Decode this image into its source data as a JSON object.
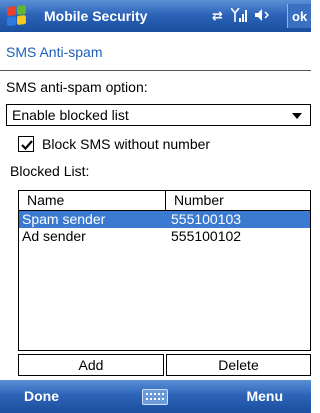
{
  "titlebar": {
    "app_title": "Mobile Security",
    "ok_label": "ok",
    "icons": [
      "connectivity-icon",
      "signal-strength-icon",
      "volume-icon"
    ]
  },
  "page": {
    "title": "SMS Anti-spam",
    "option_label": "SMS anti-spam option:",
    "option_selected": "Enable blocked list",
    "checkbox_label": "Block SMS without number",
    "checkbox_checked": true,
    "blocked_list_label": "Blocked List:"
  },
  "list": {
    "columns": [
      "Name",
      "Number"
    ],
    "rows": [
      {
        "name": "Spam sender",
        "number": "555100103",
        "selected": true
      },
      {
        "name": "Ad sender",
        "number": "555100102",
        "selected": false
      }
    ]
  },
  "buttons": {
    "add": "Add",
    "delete": "Delete"
  },
  "softkeys": {
    "left": "Done",
    "right": "Menu"
  },
  "colors": {
    "bar_blue": "#2d64b8",
    "title_blue": "#1d5eb8",
    "selection_blue": "#3a7ad0"
  }
}
